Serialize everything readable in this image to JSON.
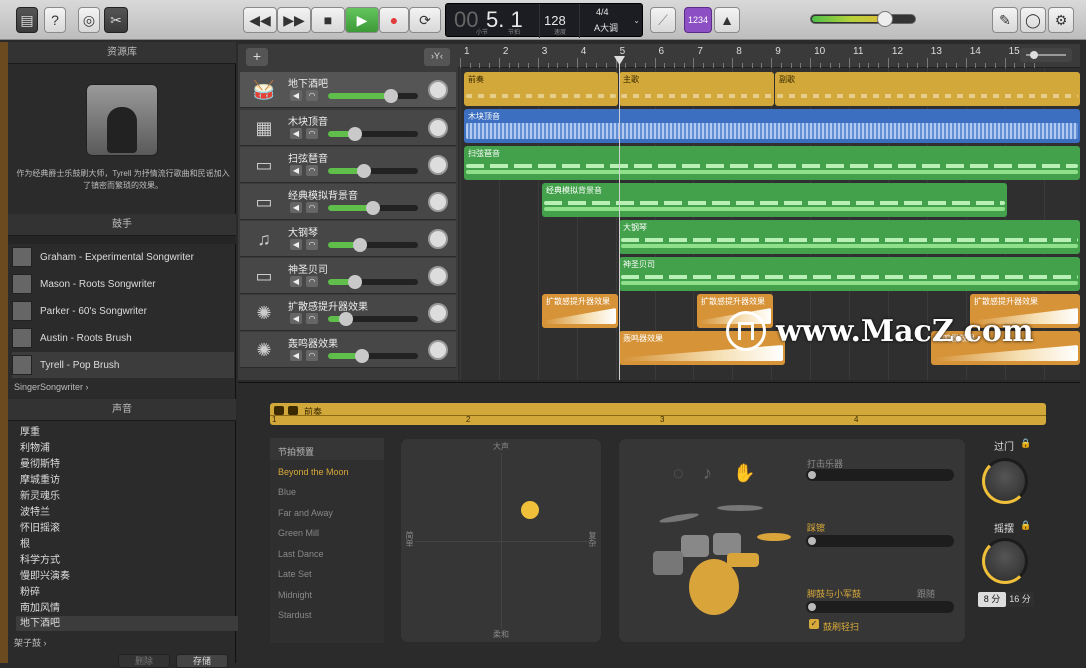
{
  "transport": {
    "bar": "00",
    "beat": "5. 1",
    "tempo": "128",
    "sig": "4/4",
    "key": "A大调",
    "lcd_sub1": "小节",
    "lcd_sub2": "节拍",
    "lcd_sub3": "速度",
    "count_in": "1234"
  },
  "library": {
    "title": "资源库",
    "artist_desc": "作为经典爵士乐鼓刷大师，Tyrell 为抒情流行歌曲和民谣加入了镇密而繁琐的效果。",
    "drummers_header": "鼓手",
    "drummers": [
      "Graham - Experimental Songwriter",
      "Mason - Roots Songwriter",
      "Parker - 60's Songwriter",
      "Austin - Roots Brush",
      "Tyrell - Pop Brush"
    ],
    "genre": "SingerSongwriter",
    "sounds_header": "声音",
    "sounds": [
      "厚重",
      "利物浦",
      "曼彻斯特",
      "摩城重访",
      "新灵魂乐",
      "波特兰",
      "怀旧摇滚",
      "根",
      "科学方式",
      "慢即兴演奏",
      "粉碎",
      "南加风情",
      "地下酒吧"
    ],
    "kit_label": "架子鼓",
    "delete_label": "删除",
    "save_label": "存储"
  },
  "tracks": [
    {
      "name": "地下酒吧",
      "icon": "drum-kit-icon",
      "vol": 0.7
    },
    {
      "name": "木块顶音",
      "icon": "drum-machine-icon",
      "vol": 0.3
    },
    {
      "name": "扫弦琶音",
      "icon": "synth-icon",
      "vol": 0.4
    },
    {
      "name": "经典模拟背景音",
      "icon": "synth-icon",
      "vol": 0.5
    },
    {
      "name": "大钢琴",
      "icon": "piano-icon",
      "vol": 0.35
    },
    {
      "name": "神圣贝司",
      "icon": "synth-icon",
      "vol": 0.3
    },
    {
      "name": "扩散感提升器效果",
      "icon": "fx-icon",
      "vol": 0.2
    },
    {
      "name": "轰鸣器效果",
      "icon": "fx-icon",
      "vol": 0.38
    }
  ],
  "ruler": [
    "1",
    "2",
    "3",
    "4",
    "5",
    "6",
    "7",
    "8",
    "9",
    "10",
    "11",
    "12",
    "13",
    "14",
    "15"
  ],
  "regions": {
    "intro": "前奏",
    "verse": "主歌",
    "chorus": "副歌",
    "wood": "木块顶音",
    "strum": "扫弦琶音",
    "analog": "经典模拟背景音",
    "piano": "大钢琴",
    "bass": "神圣贝司",
    "fx1": "扩散感提升器效果",
    "fx2": "轰鸣器效果"
  },
  "editor": {
    "region": "前奏",
    "marks": [
      "1",
      "2",
      "3",
      "4"
    ],
    "preset_header": "节拍预置",
    "presets": [
      "Beyond the Moon",
      "Blue",
      "Far and Away",
      "Green Mill",
      "Last Dance",
      "Late Set",
      "Midnight",
      "Stardust"
    ],
    "xy_top": "大声",
    "xy_bottom": "柔和",
    "xy_left": "简单",
    "xy_right": "复杂",
    "perc": "打击乐器",
    "hihat": "踩镲",
    "kick": "脚鼓与小军鼓",
    "follow": "跟随",
    "ghost": "鼓刷轻扫",
    "fill": "过门",
    "swing": "摇摆",
    "eighth": "8 分",
    "sixteenth": "16 分"
  },
  "watermark": "www.MacZ.com"
}
